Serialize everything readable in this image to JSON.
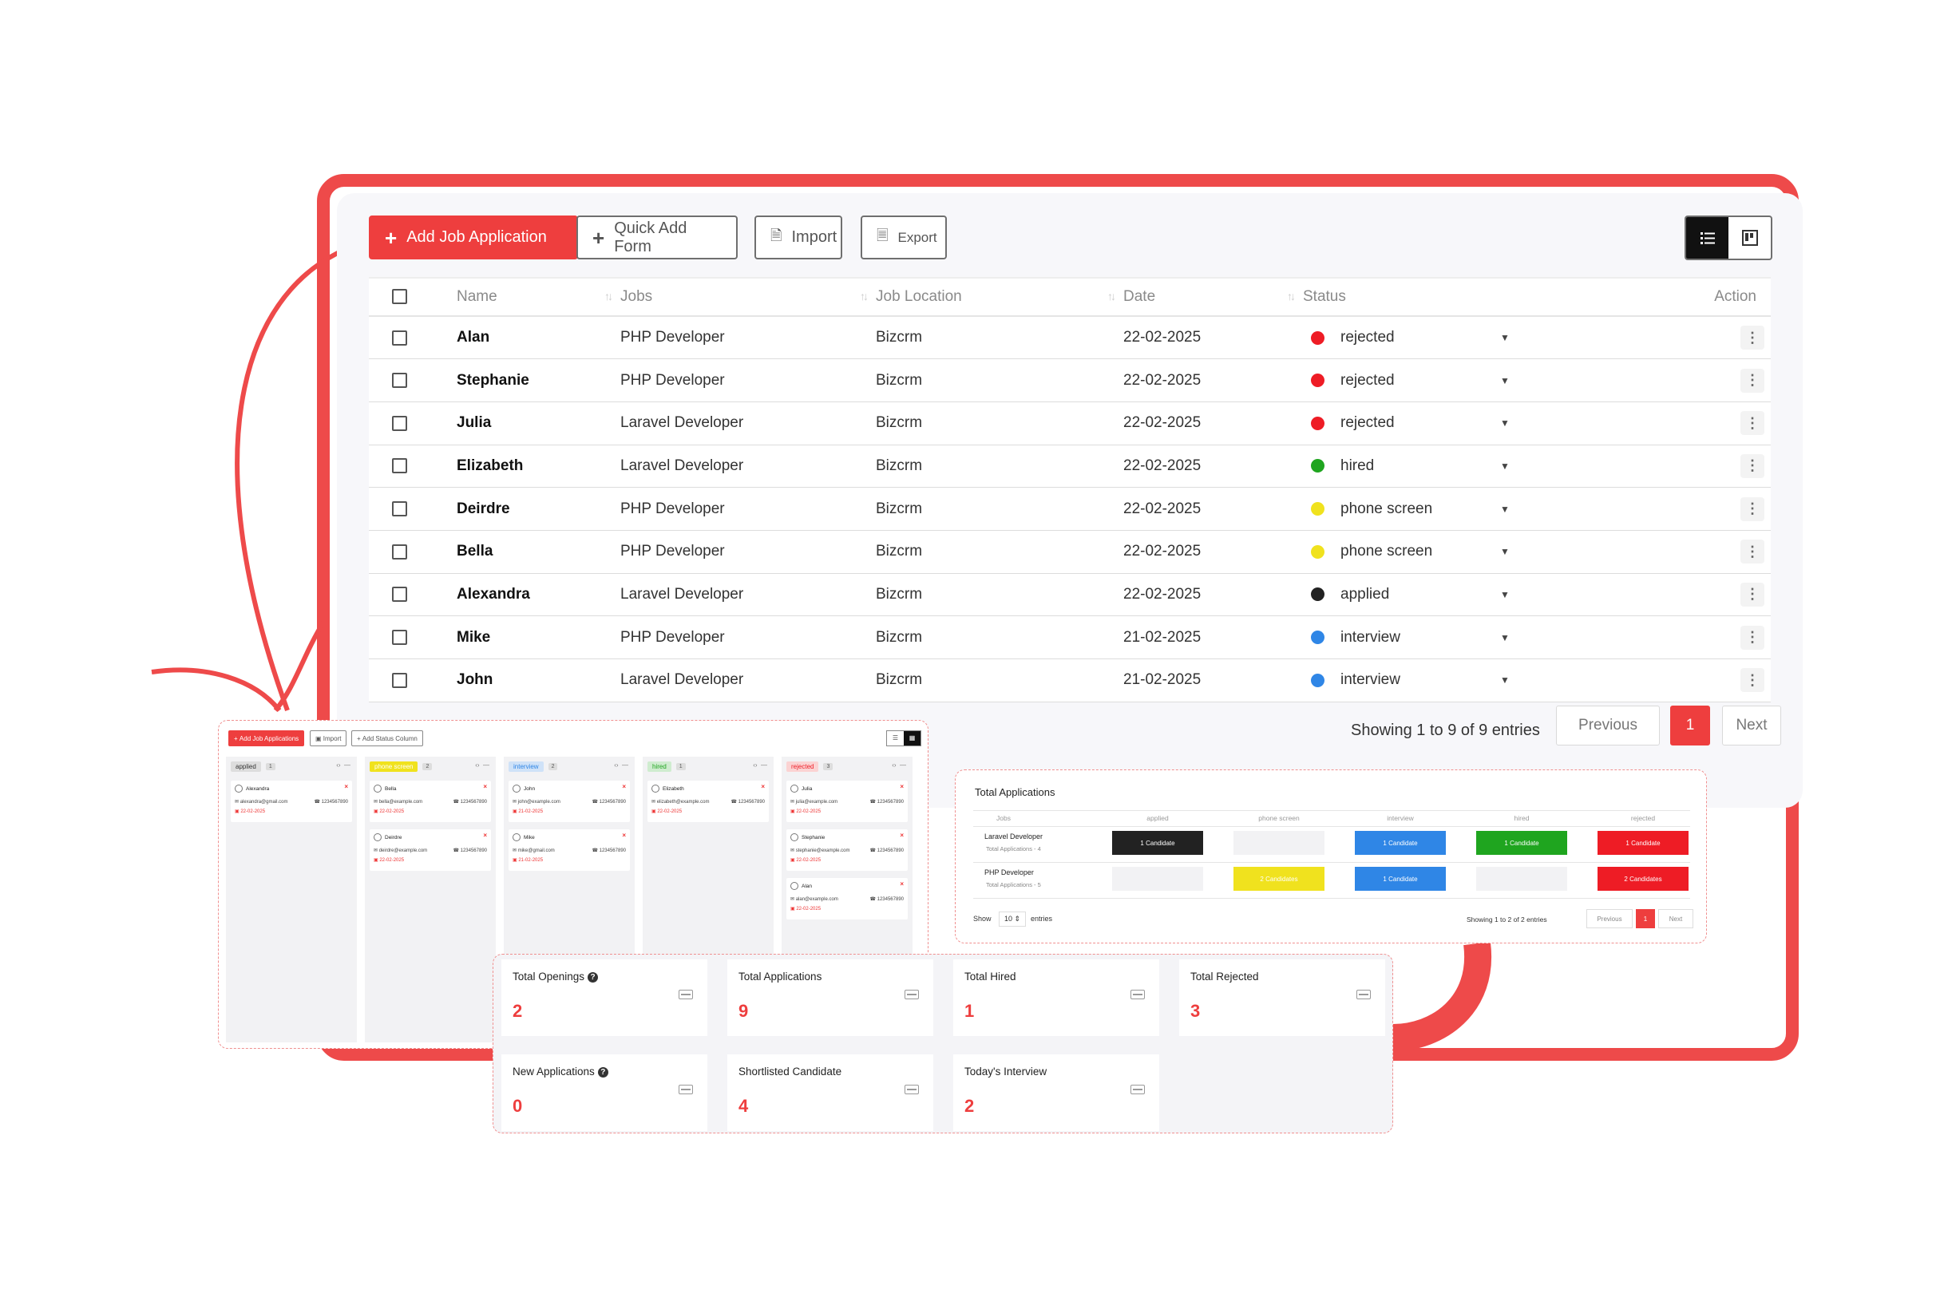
{
  "toolbar": {
    "add_job_application": "Add Job Application",
    "quick_add_form": "Quick Add Form",
    "import": "Import",
    "export": "Export"
  },
  "table": {
    "headers": [
      "Name",
      "Jobs",
      "Job Location",
      "Date",
      "Status",
      "Action"
    ],
    "rows": [
      {
        "name": "Alan",
        "job": "PHP Developer",
        "location": "Bizcrm",
        "date": "22-02-2025",
        "status": "rejected",
        "color": "#ee1c25"
      },
      {
        "name": "Stephanie",
        "job": "PHP Developer",
        "location": "Bizcrm",
        "date": "22-02-2025",
        "status": "rejected",
        "color": "#ee1c25"
      },
      {
        "name": "Julia",
        "job": "Laravel Developer",
        "location": "Bizcrm",
        "date": "22-02-2025",
        "status": "rejected",
        "color": "#ee1c25"
      },
      {
        "name": "Elizabeth",
        "job": "Laravel Developer",
        "location": "Bizcrm",
        "date": "22-02-2025",
        "status": "hired",
        "color": "#1fa51f"
      },
      {
        "name": "Deirdre",
        "job": "PHP Developer",
        "location": "Bizcrm",
        "date": "22-02-2025",
        "status": "phone screen",
        "color": "#f0e21e"
      },
      {
        "name": "Bella",
        "job": "PHP Developer",
        "location": "Bizcrm",
        "date": "22-02-2025",
        "status": "phone screen",
        "color": "#f0e21e"
      },
      {
        "name": "Alexandra",
        "job": "Laravel Developer",
        "location": "Bizcrm",
        "date": "22-02-2025",
        "status": "applied",
        "color": "#222222"
      },
      {
        "name": "Mike",
        "job": "PHP Developer",
        "location": "Bizcrm",
        "date": "21-02-2025",
        "status": "interview",
        "color": "#2f86e6"
      },
      {
        "name": "John",
        "job": "Laravel Developer",
        "location": "Bizcrm",
        "date": "21-02-2025",
        "status": "interview",
        "color": "#2f86e6"
      }
    ]
  },
  "pagination": {
    "info": "Showing 1 to 9 of 9 entries",
    "previous": "Previous",
    "current": "1",
    "next": "Next"
  },
  "kanban": {
    "add_btn": "Add Job Applications",
    "import_btn": "Import",
    "add_status_btn": "Add Status Column",
    "columns": [
      {
        "label": "applied",
        "count": "1",
        "bg": "#dddddd",
        "fg": "#333333",
        "cards": [
          {
            "name": "Alexandra",
            "email": "alexandra@gmail.com",
            "phone": "1234567890",
            "date": "22-02-2025"
          }
        ]
      },
      {
        "label": "phone screen",
        "count": "2",
        "bg": "#f0e21e",
        "fg": "#ffffff",
        "cards": [
          {
            "name": "Bella",
            "email": "bella@example.com",
            "phone": "1234567890",
            "date": "22-02-2025"
          },
          {
            "name": "Deirdre",
            "email": "deirdre@example.com",
            "phone": "1234567890",
            "date": "22-02-2025"
          }
        ]
      },
      {
        "label": "interview",
        "count": "2",
        "bg": "#cfe2f8",
        "fg": "#2f86e6",
        "cards": [
          {
            "name": "John",
            "email": "john@example.com",
            "phone": "1234567890",
            "date": "21-02-2025"
          },
          {
            "name": "Mike",
            "email": "mike@gmail.com",
            "phone": "1234567890",
            "date": "21-02-2025"
          }
        ]
      },
      {
        "label": "hired",
        "count": "1",
        "bg": "#cfeccf",
        "fg": "#1fa51f",
        "cards": [
          {
            "name": "Elizabeth",
            "email": "elizabeth@example.com",
            "phone": "1234567890",
            "date": "22-02-2025"
          }
        ]
      },
      {
        "label": "rejected",
        "count": "3",
        "bg": "#fbd3d3",
        "fg": "#ee1c25",
        "cards": [
          {
            "name": "Julia",
            "email": "julia@example.com",
            "phone": "1234567890",
            "date": "22-02-2025"
          },
          {
            "name": "Stephanie",
            "email": "stephanie@example.com",
            "phone": "1234567890",
            "date": "22-02-2025"
          },
          {
            "name": "Alan",
            "email": "alan@example.com",
            "phone": "1234567890",
            "date": "22-02-2025"
          }
        ]
      }
    ]
  },
  "totals": {
    "title": "Total Applications",
    "headers": [
      "Jobs",
      "applied",
      "phone screen",
      "interview",
      "hired",
      "rejected"
    ],
    "rows": [
      {
        "job": "Laravel Developer",
        "sub": "Total Applications - 4",
        "cells": [
          {
            "text": "1 Candidate",
            "color": "#222222"
          },
          {
            "text": "",
            "color": "#f2f2f4"
          },
          {
            "text": "1 Candidate",
            "color": "#2f86e6"
          },
          {
            "text": "1 Candidate",
            "color": "#1fa51f"
          },
          {
            "text": "1 Candidate",
            "color": "#ee1c25"
          }
        ]
      },
      {
        "job": "PHP Developer",
        "sub": "Total Applications - 5",
        "cells": [
          {
            "text": "",
            "color": "#f2f2f4"
          },
          {
            "text": "2 Candidates",
            "color": "#f0e21e"
          },
          {
            "text": "1 Candidate",
            "color": "#2f86e6"
          },
          {
            "text": "",
            "color": "#f2f2f4"
          },
          {
            "text": "2 Candidates",
            "color": "#ee1c25"
          }
        ]
      }
    ],
    "show": "Show",
    "show_value": "10",
    "entries": "entries",
    "info": "Showing 1 to 2 of 2 entries",
    "previous": "Previous",
    "current": "1",
    "next": "Next"
  },
  "stats": [
    {
      "label": "Total Openings",
      "value": "2",
      "help": true
    },
    {
      "label": "Total Applications",
      "value": "9",
      "help": false
    },
    {
      "label": "Total Hired",
      "value": "1",
      "help": false
    },
    {
      "label": "Total Rejected",
      "value": "3",
      "help": false
    },
    {
      "label": "New Applications",
      "value": "0",
      "help": true
    },
    {
      "label": "Shortlisted Candidate",
      "value": "4",
      "help": false
    },
    {
      "label": "Today's Interview",
      "value": "2",
      "help": false
    }
  ],
  "colors": {
    "accent": "#ee3e3e"
  },
  "icons": [
    "plus-icon",
    "import-icon",
    "export-icon",
    "list-view-icon",
    "board-view-icon",
    "kebab-icon",
    "caret-down-icon",
    "sort-icon",
    "help-icon",
    "wallet-icon",
    "avatar-icon",
    "close-icon"
  ]
}
